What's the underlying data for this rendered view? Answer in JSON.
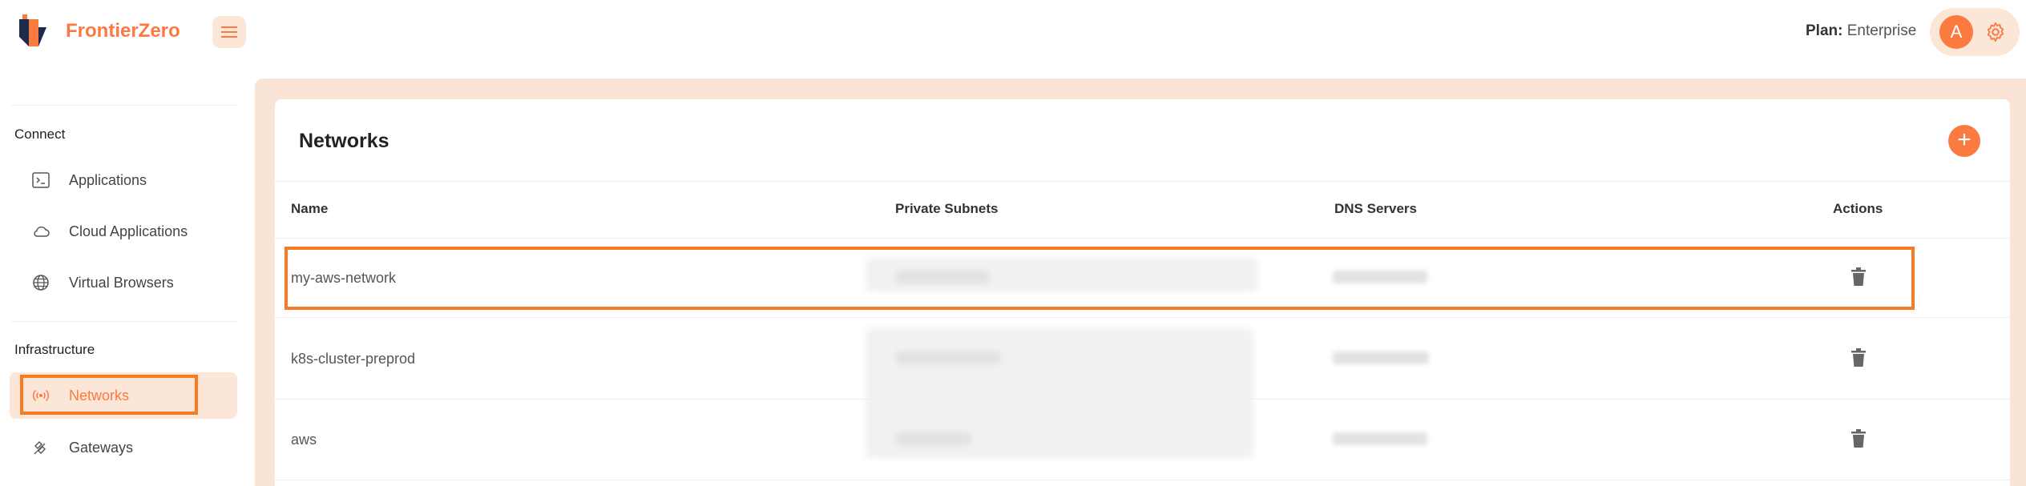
{
  "app": {
    "name": "FrontierZero",
    "brand_color": "#fa7a3f"
  },
  "header": {
    "plan_label": "Plan:",
    "plan_value": "Enterprise",
    "avatar_initial": "A"
  },
  "sidebar": {
    "sections": [
      {
        "title": "Connect",
        "items": [
          {
            "label": "Applications",
            "icon": "terminal-icon"
          },
          {
            "label": "Cloud Applications",
            "icon": "cloud-icon"
          },
          {
            "label": "Virtual Browsers",
            "icon": "globe-icon"
          }
        ]
      },
      {
        "title": "Infrastructure",
        "items": [
          {
            "label": "Networks",
            "icon": "broadcast-icon",
            "active": true
          },
          {
            "label": "Gateways",
            "icon": "satellite-icon"
          }
        ]
      }
    ]
  },
  "networks": {
    "title": "Networks",
    "add_label": "+",
    "columns": [
      "Name",
      "Private Subnets",
      "DNS Servers",
      "Actions"
    ],
    "rows": [
      {
        "name": "my-aws-network"
      },
      {
        "name": "k8s-cluster-preprod"
      },
      {
        "name": "aws"
      }
    ]
  }
}
